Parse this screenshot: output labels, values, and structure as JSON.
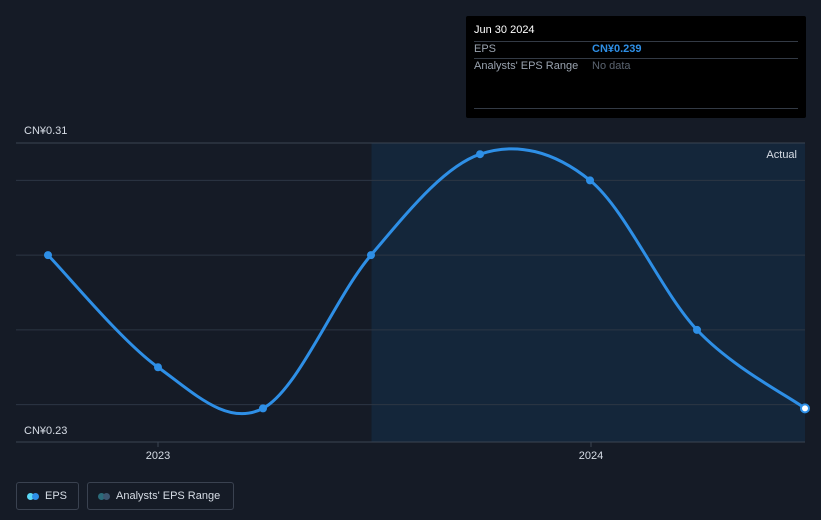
{
  "chart_data": {
    "type": "line",
    "y_label_top": "CN¥0.31",
    "y_label_bottom": "CN¥0.23",
    "ylim": [
      0.23,
      0.31
    ],
    "x_tick_labels": [
      {
        "label": "2023",
        "date": "2023-01-01"
      },
      {
        "label": "2024",
        "date": "2024-01-01"
      }
    ],
    "actual_region_start": "2023-06-30",
    "actual_label": "Actual",
    "series": [
      {
        "name": "EPS",
        "color": "#2e8fe6",
        "points": [
          {
            "date": "2022-06-30",
            "value": 0.28
          },
          {
            "date": "2022-12-31",
            "value": 0.25
          },
          {
            "date": "2023-06-30",
            "value": 0.239
          },
          {
            "date": "2023-06-30",
            "value": 0.28
          },
          {
            "date": "2023-06-30",
            "value": 0.307
          },
          {
            "date": "2023-12-31",
            "value": 0.3
          },
          {
            "date": "2024-03-31",
            "value": 0.26
          },
          {
            "date": "2024-06-30",
            "value": 0.239
          }
        ]
      }
    ]
  },
  "tooltip": {
    "date": "Jun 30 2024",
    "eps_label": "EPS",
    "eps_value": "CN¥0.239",
    "range_label": "Analysts' EPS Range",
    "range_value": "No data"
  },
  "legend": {
    "eps_label": "EPS",
    "range_label": "Analysts' EPS Range",
    "eps_colors": [
      "#5ad8f5",
      "#2e8fe6"
    ],
    "range_colors": [
      "#2b6b7a",
      "#3d5670"
    ]
  },
  "colors": {
    "background": "#151b26",
    "actual_region": "#14263a",
    "grid": "#2c3644",
    "line": "#2e8fe6"
  }
}
